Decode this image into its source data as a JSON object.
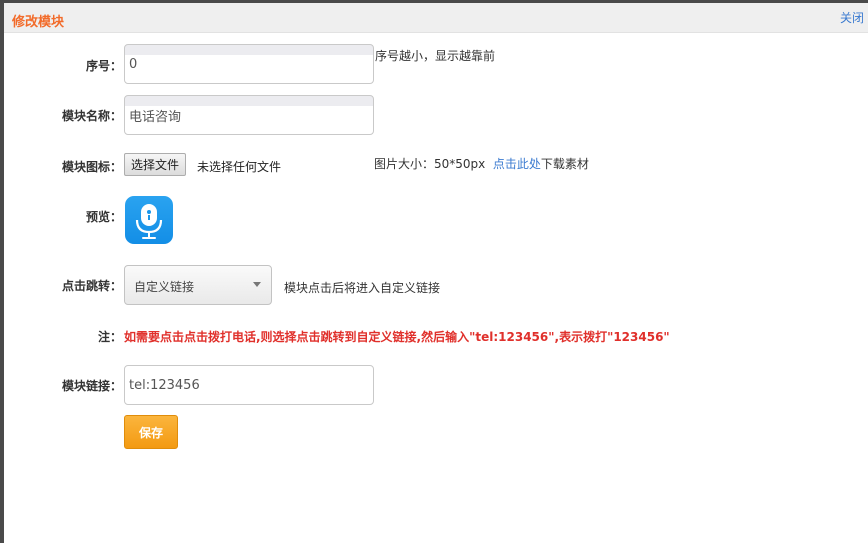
{
  "dialog": {
    "title": "修改模块",
    "close_label": "关闭"
  },
  "form": {
    "order": {
      "label": "序号：",
      "value": "0",
      "hint": "序号越小，显示越靠前"
    },
    "name": {
      "label": "模块名称：",
      "value": "电话咨询"
    },
    "icon": {
      "label": "模块图标：",
      "choose_button": "选择文件",
      "file_status": "未选择任何文件",
      "size_hint": "图片大小：50*50px",
      "download_link": "点击此处",
      "download_suffix": "下载素材"
    },
    "preview": {
      "label": "预览：",
      "icon_name": "microphone-icon",
      "icon_color": "#1a96ea"
    },
    "jump": {
      "label": "点击跳转：",
      "selected": "自定义链接",
      "hint": "模块点击后将进入自定义链接"
    },
    "note": {
      "label": "注：",
      "text": "如需要点击点击拨打电话,则选择点击跳转到自定义链接,然后输入\"tel:123456\",表示拨打\"123456\""
    },
    "link": {
      "label": "模块链接：",
      "value": "tel:123456"
    },
    "save_label": "保存"
  },
  "colors": {
    "title": "#f26b2a",
    "link": "#3b7bd0",
    "note": "#e0302b",
    "save": "#f5a623"
  }
}
